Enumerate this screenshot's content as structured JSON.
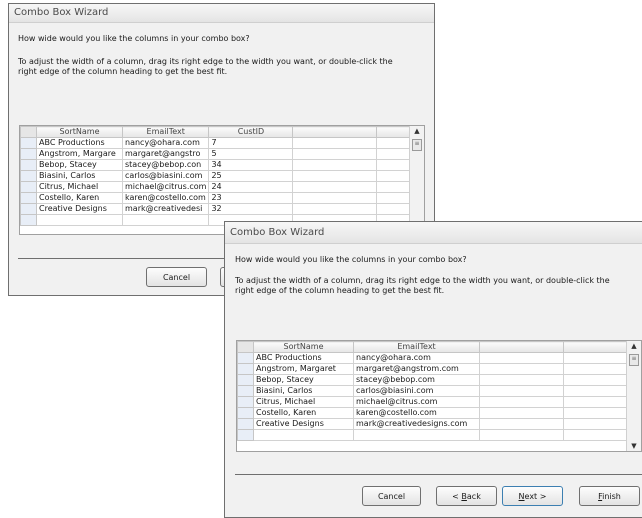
{
  "back_window": {
    "title": "Combo Box Wizard",
    "question": "How wide would you like the columns in your combo box?",
    "instruction_line1": "To adjust the width of a column, drag its right edge to the width you want, or double-click the",
    "instruction_line2": "right edge of the column heading to get the best fit.",
    "grid": {
      "headers": [
        "SortName",
        "EmailText",
        "CustID"
      ],
      "rows": [
        [
          "ABC Productions",
          "nancy@ohara.com",
          "7"
        ],
        [
          "Angstrom, Margare",
          "margaret@angstro",
          "5"
        ],
        [
          "Bebop, Stacey",
          "stacey@bebop.con",
          "34"
        ],
        [
          "Biasini, Carlos",
          "carlos@biasini.com",
          "25"
        ],
        [
          "Citrus, Michael",
          "michael@citrus.com",
          "24"
        ],
        [
          "Costello, Karen",
          "karen@costello.com",
          "23"
        ],
        [
          "Creative Designs",
          "mark@creativedesi",
          "32"
        ]
      ]
    },
    "buttons": {
      "cancel": "Cancel"
    }
  },
  "front_window": {
    "title": "Combo Box Wizard",
    "question": "How wide would you like the columns in your combo box?",
    "instruction_line1": "To adjust the width of a column, drag its right edge to the width you want, or double-click the",
    "instruction_line2": "right edge of the column heading to get the best fit.",
    "grid": {
      "headers": [
        "SortName",
        "EmailText"
      ],
      "rows": [
        [
          "ABC Productions",
          "nancy@ohara.com"
        ],
        [
          "Angstrom, Margaret",
          "margaret@angstrom.com"
        ],
        [
          "Bebop, Stacey",
          "stacey@bebop.com"
        ],
        [
          "Biasini, Carlos",
          "carlos@biasini.com"
        ],
        [
          "Citrus, Michael",
          "michael@citrus.com"
        ],
        [
          "Costello, Karen",
          "karen@costello.com"
        ],
        [
          "Creative Designs",
          "mark@creativedesigns.com"
        ]
      ]
    },
    "buttons": {
      "cancel": "Cancel",
      "back_accel": "B",
      "back_prefix": "< ",
      "back_rest": "ack",
      "next_accel": "N",
      "next_rest": "ext >",
      "finish_accel": "F",
      "finish_rest": "inish"
    }
  }
}
